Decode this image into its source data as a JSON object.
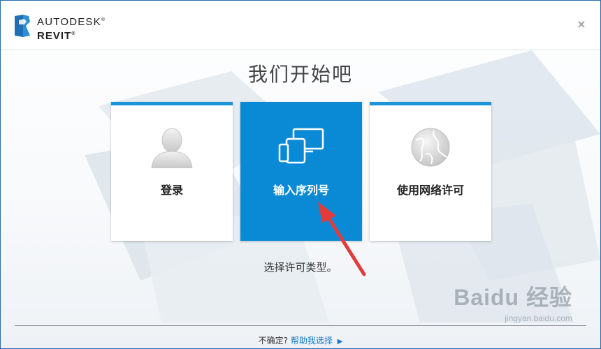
{
  "header": {
    "brand_line1": "AUTODESK",
    "brand_line1_mark": "®",
    "brand_line2": "REVIT",
    "brand_line2_mark": "®",
    "close_label": "×"
  },
  "main": {
    "title": "我们开始吧",
    "cards": [
      {
        "label": "登录",
        "icon": "user-icon",
        "active": false
      },
      {
        "label": "输入序列号",
        "icon": "devices-icon",
        "active": true
      },
      {
        "label": "使用网络许可",
        "icon": "globe-icon",
        "active": false
      }
    ],
    "hint": "选择许可类型。"
  },
  "footer": {
    "question": "不确定?",
    "help_link": "帮助我选择",
    "arrow": "▶"
  },
  "watermark": {
    "line1": "Baidu 经验",
    "line2": "jingyan.baidu.com"
  },
  "colors": {
    "accent": "#1c94d8",
    "active_card": "#0a8ad4",
    "annotation_arrow": "#e23b3b"
  }
}
